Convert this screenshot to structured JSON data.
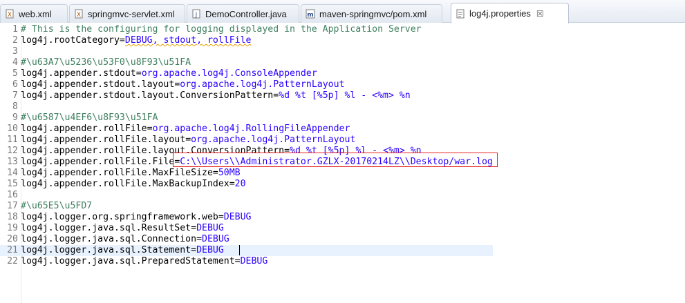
{
  "tabs": [
    {
      "label": "web.xml",
      "icon": "xml-file-icon",
      "active": false
    },
    {
      "label": "springmvc-servlet.xml",
      "icon": "xml-file-icon",
      "active": false
    },
    {
      "label": "DemoController.java",
      "icon": "java-file-icon",
      "active": false
    },
    {
      "label": "maven-springmvc/pom.xml",
      "icon": "maven-pom-icon",
      "active": false
    },
    {
      "label": "log4j.properties",
      "icon": "properties-file-icon",
      "active": true,
      "close": "☒"
    }
  ],
  "editor": {
    "lines": [
      {
        "n": "1",
        "comment": "# This is the configuring for logging displayed in the Application Server"
      },
      {
        "n": "2",
        "key": "log4j.rootCategory",
        "eq": "=",
        "val": "DEBUG, stdout, rollFile"
      },
      {
        "n": "3"
      },
      {
        "n": "4",
        "comment": "#\\u63A7\\u5236\\u53F0\\u8F93\\u51FA"
      },
      {
        "n": "5",
        "key": "log4j.appender.stdout",
        "eq": "=",
        "val": "org.apache.log4j.ConsoleAppender"
      },
      {
        "n": "6",
        "key": "log4j.appender.stdout.layout",
        "eq": "=",
        "val": "org.apache.log4j.PatternLayout"
      },
      {
        "n": "7",
        "key": "log4j.appender.stdout.layout.ConversionPattern",
        "eq": "=",
        "val": "%d %t [%5p] %l - <%m> %n"
      },
      {
        "n": "8"
      },
      {
        "n": "9",
        "comment": "#\\u6587\\u4EF6\\u8F93\\u51FA"
      },
      {
        "n": "10",
        "key": "log4j.appender.rollFile",
        "eq": "=",
        "val": "org.apache.log4j.RollingFileAppender"
      },
      {
        "n": "11",
        "key": "log4j.appender.rollFile.layout",
        "eq": "=",
        "val": "org.apache.log4j.PatternLayout"
      },
      {
        "n": "12",
        "key": "log4j.appender.rollFile.layout.ConversionPattern",
        "eq": "=",
        "val": "%d %t [%5p] %l - <%m> %n"
      },
      {
        "n": "13",
        "key": "log4j.appender.rollFile.File",
        "eq": "=",
        "val": "C:\\\\Users\\\\Administrator.GZLX-20170214LZ\\\\Desktop/war.log"
      },
      {
        "n": "14",
        "key": "log4j.appender.rollFile.MaxFileSize",
        "eq": "=",
        "val": "50MB"
      },
      {
        "n": "15",
        "key": "log4j.appender.rollFile.MaxBackupIndex",
        "eq": "=",
        "val": "20"
      },
      {
        "n": "16"
      },
      {
        "n": "17",
        "comment": "#\\u65E5\\u5FD7"
      },
      {
        "n": "18",
        "key": "log4j.logger.org.springframework.web",
        "eq": "=",
        "val": "DEBUG"
      },
      {
        "n": "19",
        "key": "log4j.logger.java.sql.ResultSet",
        "eq": "=",
        "val": "DEBUG"
      },
      {
        "n": "20",
        "key": "log4j.logger.java.sql.Connection",
        "eq": "=",
        "val": "DEBUG"
      },
      {
        "n": "21",
        "key": "log4j.logger.java.sql.Statement",
        "eq": "=",
        "val": "DEBUG"
      },
      {
        "n": "22",
        "key": "log4j.logger.java.sql.PreparedStatement",
        "eq": "=",
        "val": "DEBUG"
      }
    ]
  },
  "colors": {
    "comment": "#3f7f5f",
    "value": "#2a00ff",
    "highlight_box": "#e02020"
  }
}
